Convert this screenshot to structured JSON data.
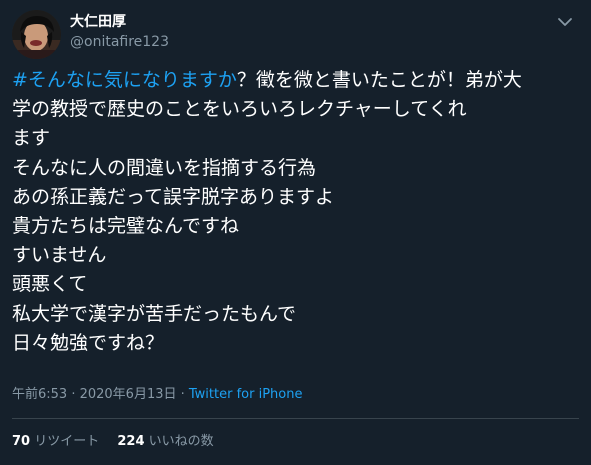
{
  "user": {
    "display_name": "大仁田厚",
    "handle": "@onitafire123"
  },
  "tweet": {
    "hashtag": "#そんなに気になりますか",
    "lines": [
      "？徵を微と書いたことが！弟が大",
      "学の教授で歴史のことをいろいろレクチャーしてくれ",
      "ます",
      "そんなに人の間違いを指摘する行為",
      "あの孫正義だって誤字脱字ありますよ",
      "貴方たちは完璧なんですね",
      "すいません",
      "頭悪くて",
      "私大学で漢字が苦手だったもんで",
      "日々勉強ですね？"
    ],
    "timestamp": "午前6:53 · 2020年6月13日 · ",
    "source": "Twitter for iPhone"
  },
  "stats": {
    "retweets_count": "70",
    "retweets_label": "リツイート",
    "likes_count": "224",
    "likes_label": "いいねの数"
  },
  "icons": {
    "menu": "chevron-down-icon",
    "avatar": "avatar"
  },
  "colors": {
    "background": "#15202b",
    "text": "#ffffff",
    "secondary": "#8899a6",
    "accent": "#1da1f2",
    "divider": "#38444d"
  }
}
